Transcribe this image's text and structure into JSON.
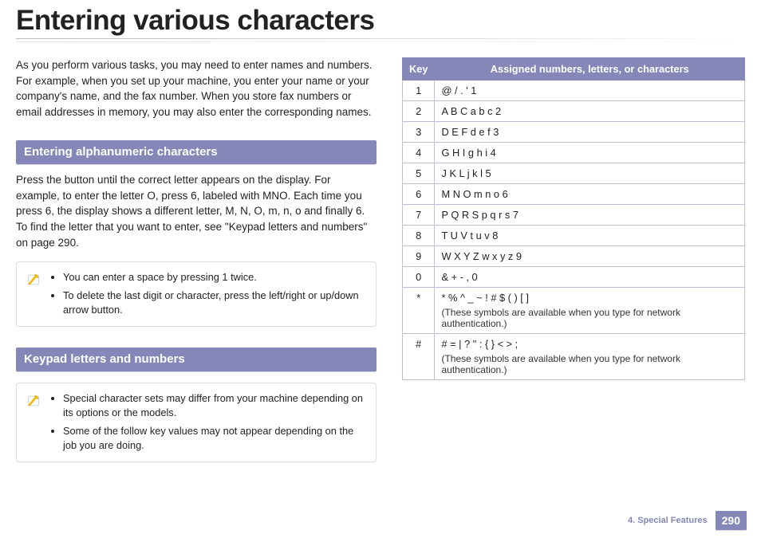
{
  "heading": "Entering various characters",
  "intro": "As you perform various tasks, you may need to enter names and numbers. For example, when you set up your machine, you enter your name or your company's name, and the fax number. When you store fax numbers or email addresses in memory, you may also enter the corresponding names.",
  "section1": {
    "title": "Entering alphanumeric characters",
    "body": "Press the button until the correct letter appears on the display. For example, to enter the letter O, press 6, labeled with MNO. Each time you press 6, the display shows a different letter, M, N, O, m, n, o and finally 6. To find the letter that you want to enter, see \"Keypad letters and numbers\" on page 290.",
    "notes": [
      "You can enter a space by pressing 1 twice.",
      "To delete the last digit or character, press the left/right or up/down arrow button."
    ]
  },
  "section2": {
    "title": "Keypad letters and numbers",
    "notes": [
      "Special character sets may differ from your machine depending on its options or the models.",
      "Some of the follow key values may not appear depending on the job you are doing."
    ]
  },
  "table": {
    "header_key": "Key",
    "header_chars": "Assigned numbers, letters, or characters",
    "network_note": "(These symbols are available when you type for network authentication.)",
    "rows": [
      {
        "key": "1",
        "chars": "@ / . ' 1"
      },
      {
        "key": "2",
        "chars": "A B C a b c 2"
      },
      {
        "key": "3",
        "chars": "D E F d e f 3"
      },
      {
        "key": "4",
        "chars": "G H I g h i 4"
      },
      {
        "key": "5",
        "chars": "J K L j k l 5"
      },
      {
        "key": "6",
        "chars": "M N O m n o 6"
      },
      {
        "key": "7",
        "chars": "P Q R S p q r s 7"
      },
      {
        "key": "8",
        "chars": "T U V t u v 8"
      },
      {
        "key": "9",
        "chars": "W X Y Z w x y z 9"
      },
      {
        "key": "0",
        "chars": "& + - , 0"
      },
      {
        "key": "*",
        "chars": "* % ^ _ ~ ! # $ ( ) [ ]",
        "has_note": true
      },
      {
        "key": "#",
        "chars": "# = | ? \" : { } < > ;",
        "has_note": true
      }
    ]
  },
  "footer": {
    "chapter": "4.  Special Features",
    "page": "290"
  }
}
